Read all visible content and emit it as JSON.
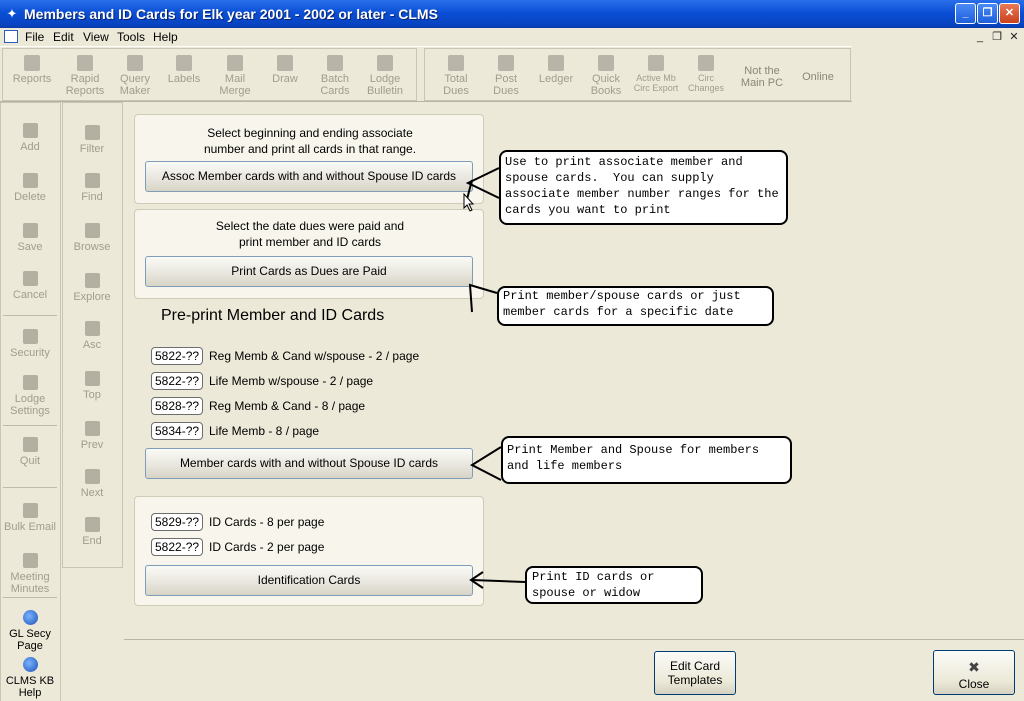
{
  "window": {
    "title": "Members and ID Cards for Elk year 2001 - 2002 or later - CLMS"
  },
  "menu": [
    "File",
    "Edit",
    "View",
    "Tools",
    "Help"
  ],
  "toolbar": {
    "group1": [
      "Reports",
      "Rapid Reports",
      "Query Maker",
      "Labels",
      "Mail Merge",
      "Draw",
      "Batch Cards",
      "Lodge Bulletin"
    ],
    "group2": [
      "Total Dues",
      "Post Dues",
      "Ledger",
      "Quick Books",
      "Active Mb Circ Export",
      "Circ Changes"
    ],
    "not_main_pc": "Not the Main PC",
    "online": "Online"
  },
  "sidebar_left": [
    "Add",
    "Delete",
    "Save",
    "Cancel",
    "Security",
    "Lodge Settings",
    "Quit",
    "Bulk Email",
    "Meeting Minutes",
    "GL Secy Page",
    "CLMS KB Help"
  ],
  "sidebar_right": [
    "Filter",
    "Find",
    "Browse",
    "Explore",
    "Asc",
    "Top",
    "Prev",
    "Next",
    "End"
  ],
  "panel1": {
    "line1": "Select beginning and ending associate",
    "line2": "number and print all cards in that range.",
    "button": "Assoc Member cards with and without Spouse ID cards"
  },
  "panel2": {
    "line1": "Select the date dues were paid and",
    "line2": "print member and ID cards",
    "button": "Print Cards as Dues are Paid"
  },
  "preprint": {
    "heading": "Pre-print Member and ID Cards",
    "items": [
      {
        "code": "5822-??",
        "label": "Reg Memb & Cand w/spouse - 2 / page"
      },
      {
        "code": "5822-??",
        "label": "Life Memb w/spouse - 2 / page"
      },
      {
        "code": "5828-??",
        "label": "Reg Memb & Cand - 8 / page"
      },
      {
        "code": "5834-??",
        "label": "Life Memb  - 8 / page"
      }
    ],
    "button": "Member cards with and without Spouse ID cards"
  },
  "idpanel": {
    "items": [
      {
        "code": "5829-??",
        "label": "ID Cards -   8 per page"
      },
      {
        "code": "5822-??",
        "label": "ID Cards -   2 per page"
      }
    ],
    "button": "Identification Cards"
  },
  "callouts": {
    "c1": "Use to print associate member and spouse cards.  You can supply associate member number ranges for the cards you want to print",
    "c2": "Print member/spouse cards or just member cards for a specific date",
    "c3": "Print Member and Spouse for members and life members",
    "c4": "Print ID cards or spouse or widow"
  },
  "bottom": {
    "edit_templates": "Edit Card Templates",
    "close": "Close"
  }
}
